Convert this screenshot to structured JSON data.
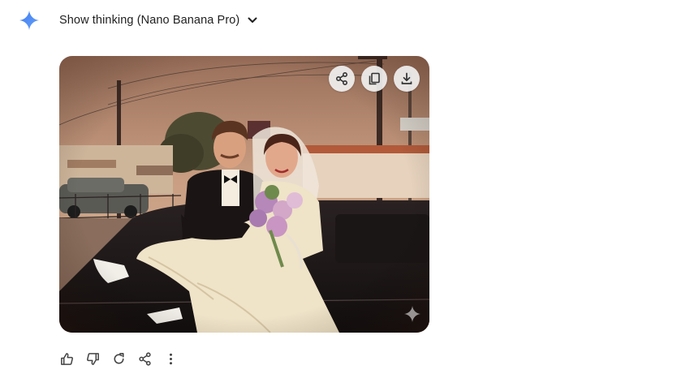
{
  "header": {
    "thinking_label": "Show thinking (Nano Banana Pro)",
    "logo_icon": "gemini-sparkle-icon",
    "toggle_icon": "chevron-down-icon",
    "accent_color": "#4f8df5"
  },
  "image": {
    "description_icon": "generated-image",
    "overlay_actions": [
      {
        "name": "share",
        "icon": "share-icon"
      },
      {
        "name": "copy",
        "icon": "copy-icon"
      },
      {
        "name": "download",
        "icon": "download-icon"
      }
    ],
    "watermark_icon": "sparkle-watermark-icon"
  },
  "actions": [
    {
      "name": "good-response",
      "icon": "thumb-up-icon"
    },
    {
      "name": "bad-response",
      "icon": "thumb-down-icon"
    },
    {
      "name": "redo",
      "icon": "refresh-icon"
    },
    {
      "name": "share",
      "icon": "share-icon"
    },
    {
      "name": "more",
      "icon": "more-vert-icon"
    }
  ]
}
